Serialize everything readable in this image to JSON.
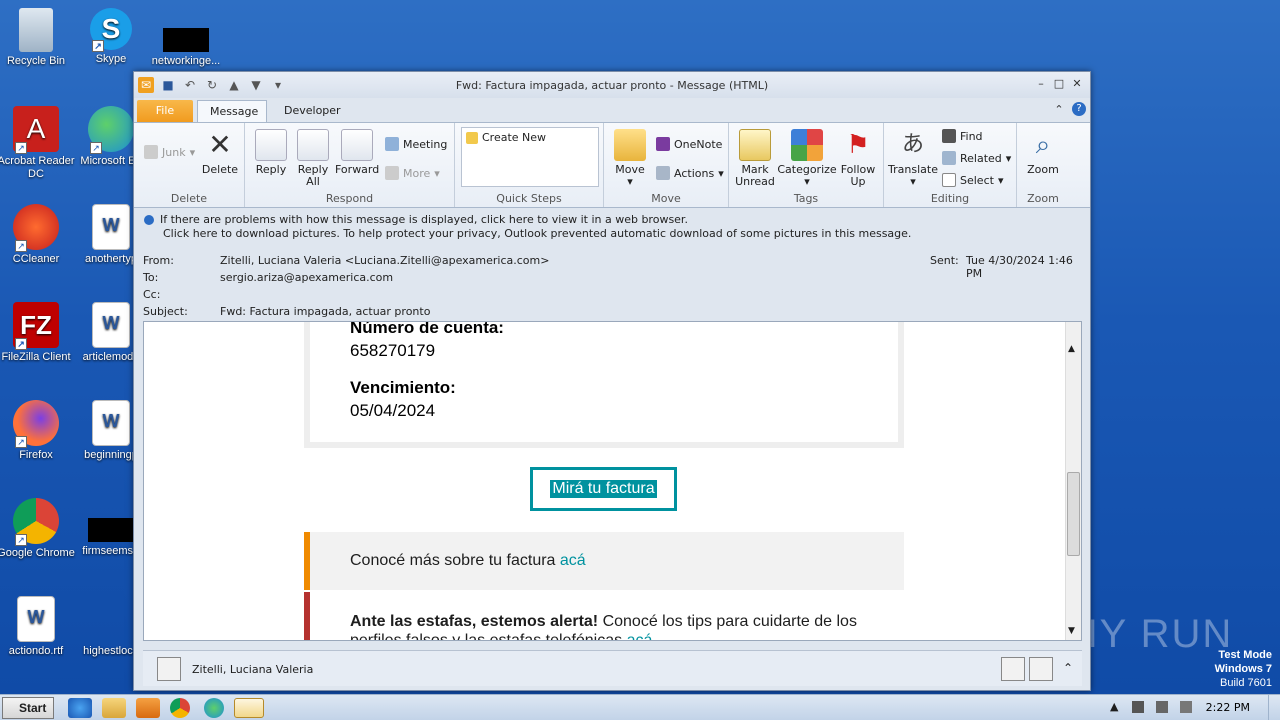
{
  "desktop": {
    "icons": [
      {
        "label": "Recycle Bin"
      },
      {
        "label": "Skype"
      },
      {
        "label": "networkinge..."
      },
      {
        "label": "Acrobat Reader DC"
      },
      {
        "label": "Microsoft Ed"
      },
      {
        "label": "CCleaner"
      },
      {
        "label": "anothertyp"
      },
      {
        "label": "FileZilla Client"
      },
      {
        "label": "articlemode"
      },
      {
        "label": "Firefox"
      },
      {
        "label": "beginningp"
      },
      {
        "label": "Google Chrome"
      },
      {
        "label": "firmseems.r"
      },
      {
        "label": "actiondo.rtf"
      },
      {
        "label": "highestloca"
      }
    ],
    "watermark": {
      "line1": "Test Mode",
      "line2": "Windows 7",
      "line3": "Build 7601"
    },
    "anyrun": "ANY RUN"
  },
  "window": {
    "title": "Fwd: Factura impagada, actuar pronto  -  Message (HTML)",
    "tabs": {
      "file": "File",
      "message": "Message",
      "developer": "Developer"
    }
  },
  "ribbon": {
    "delete": {
      "junk": "Junk",
      "delete": "Delete",
      "group": "Delete"
    },
    "respond": {
      "reply": "Reply",
      "reply_all": "Reply All",
      "forward": "Forward",
      "meeting": "Meeting",
      "more": "More",
      "group": "Respond"
    },
    "quick_steps": {
      "create_new": "Create New",
      "group": "Quick Steps"
    },
    "move": {
      "move": "Move",
      "onenote": "OneNote",
      "actions": "Actions",
      "group": "Move"
    },
    "tags": {
      "mark_unread": "Mark Unread",
      "categorize": "Categorize",
      "follow_up": "Follow Up",
      "group": "Tags"
    },
    "editing": {
      "translate": "Translate",
      "find": "Find",
      "related": "Related",
      "select": "Select",
      "group": "Editing"
    },
    "zoom": {
      "zoom": "Zoom",
      "group": "Zoom"
    }
  },
  "infobar": {
    "line1": "If there are problems with how this message is displayed, click here to view it in a web browser.",
    "line2": "Click here to download pictures. To help protect your privacy, Outlook prevented automatic download of some pictures in this message."
  },
  "header": {
    "from_label": "From:",
    "from": "Zitelli, Luciana Valeria <Luciana.Zitelli@apexamerica.com>",
    "to_label": "To:",
    "to": "sergio.ariza@apexamerica.com",
    "cc_label": "Cc:",
    "cc": "",
    "subject_label": "Subject:",
    "subject": "Fwd: Factura impagada, actuar pronto",
    "sent_label": "Sent:",
    "sent": "Tue 4/30/2024 1:46 PM"
  },
  "body": {
    "account_label": "Número de cuenta:",
    "account": "658270179",
    "due_label": "Vencimiento:",
    "due": "05/04/2024",
    "cta": "Mirá tu factura",
    "info_text": "Conocé más sobre tu factura ",
    "info_link": "acá",
    "alert_bold": "Ante las estafas, estemos alerta!",
    "alert_text": " Conocé los tips para cuidarte de los perfiles falsos y las estafas telefónicas ",
    "alert_link": "acá"
  },
  "people": {
    "name": "Zitelli, Luciana Valeria"
  },
  "taskbar": {
    "start": "Start",
    "clock": "2:22 PM"
  },
  "colors": {
    "accent": "#00929f",
    "orange": "#f08a00",
    "red": "#b5322f"
  }
}
